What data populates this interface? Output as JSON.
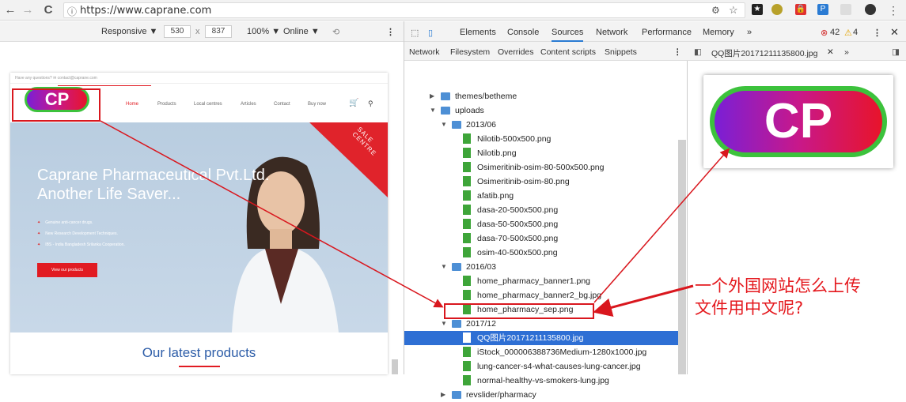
{
  "browser": {
    "url": "https://www.caprane.com",
    "back_icon": "←",
    "forward_icon": "→",
    "reload_icon": "C",
    "info_icon": "ⓘ"
  },
  "device_toolbar": {
    "mode": "Responsive ▼",
    "width": "530",
    "sep": "x",
    "height": "837",
    "zoom": "100% ▼",
    "network": "Online ▼"
  },
  "site": {
    "topbar": "Have any questions?   ✉ contact@caprane.com",
    "logo": "CP",
    "nav": [
      "Home",
      "Products",
      "Local centres",
      "Articles",
      "Contact",
      "Buy now"
    ],
    "hero_title": "Caprane Pharmaceutical Pvt.Ltd. Another Life Saver...",
    "bullets": [
      "Genuine anti-cancer drugs.",
      "New Research Development Techniques.",
      "IBS - India Bangladesh Srilanka Cooperation."
    ],
    "hero_button": "View our products",
    "sale_band": "SALE CENTRE",
    "latest": "Our latest products"
  },
  "devtools": {
    "tabs": [
      "Elements",
      "Console",
      "Sources",
      "Network",
      "Performance",
      "Memory",
      "»"
    ],
    "active_tab": "Sources",
    "errors": "42",
    "warnings": "4",
    "source_tabs": [
      "Network",
      "Filesystem",
      "Overrides",
      "Content scripts",
      "Snippets"
    ],
    "editor_tab": "QQ图片20171211135800.jpg",
    "editor_more": "»"
  },
  "tree": [
    {
      "type": "folder",
      "indent": 0,
      "arrow": "▶",
      "label": "themes/betheme"
    },
    {
      "type": "folder",
      "indent": 0,
      "arrow": "▼",
      "label": "uploads"
    },
    {
      "type": "folder",
      "indent": 1,
      "arrow": "▼",
      "label": "2013/06"
    },
    {
      "type": "file",
      "indent": 2,
      "label": "Nilotib-500x500.png"
    },
    {
      "type": "file",
      "indent": 2,
      "label": "Nilotib.png"
    },
    {
      "type": "file",
      "indent": 2,
      "label": "Osimeritinib-osim-80-500x500.png"
    },
    {
      "type": "file",
      "indent": 2,
      "label": "Osimeritinib-osim-80.png"
    },
    {
      "type": "file",
      "indent": 2,
      "label": "afatib.png"
    },
    {
      "type": "file",
      "indent": 2,
      "label": "dasa-20-500x500.png"
    },
    {
      "type": "file",
      "indent": 2,
      "label": "dasa-50-500x500.png"
    },
    {
      "type": "file",
      "indent": 2,
      "label": "dasa-70-500x500.png"
    },
    {
      "type": "file",
      "indent": 2,
      "label": "osim-40-500x500.png"
    },
    {
      "type": "folder",
      "indent": 1,
      "arrow": "▼",
      "label": "2016/03"
    },
    {
      "type": "file",
      "indent": 2,
      "label": "home_pharmacy_banner1.png"
    },
    {
      "type": "file",
      "indent": 2,
      "label": "home_pharmacy_banner2_bg.jpg"
    },
    {
      "type": "file",
      "indent": 2,
      "label": "home_pharmacy_sep.png"
    },
    {
      "type": "folder",
      "indent": 1,
      "arrow": "▼",
      "label": "2017/12"
    },
    {
      "type": "file",
      "indent": 2,
      "label": "QQ图片20171211135800.jpg",
      "selected": true
    },
    {
      "type": "file",
      "indent": 2,
      "label": "iStock_000006388736Medium-1280x1000.jpg"
    },
    {
      "type": "file",
      "indent": 2,
      "label": "lung-cancer-s4-what-causes-lung-cancer.jpg"
    },
    {
      "type": "file",
      "indent": 2,
      "label": "normal-healthy-vs-smokers-lung.jpg"
    },
    {
      "type": "folder",
      "indent": 1,
      "arrow": "▶",
      "label": "revslider/pharmacy"
    }
  ],
  "annotation": {
    "question": "一个外国网站怎么上传文件用中文呢?",
    "color": "#e4171c"
  },
  "preview_logo": "CP"
}
